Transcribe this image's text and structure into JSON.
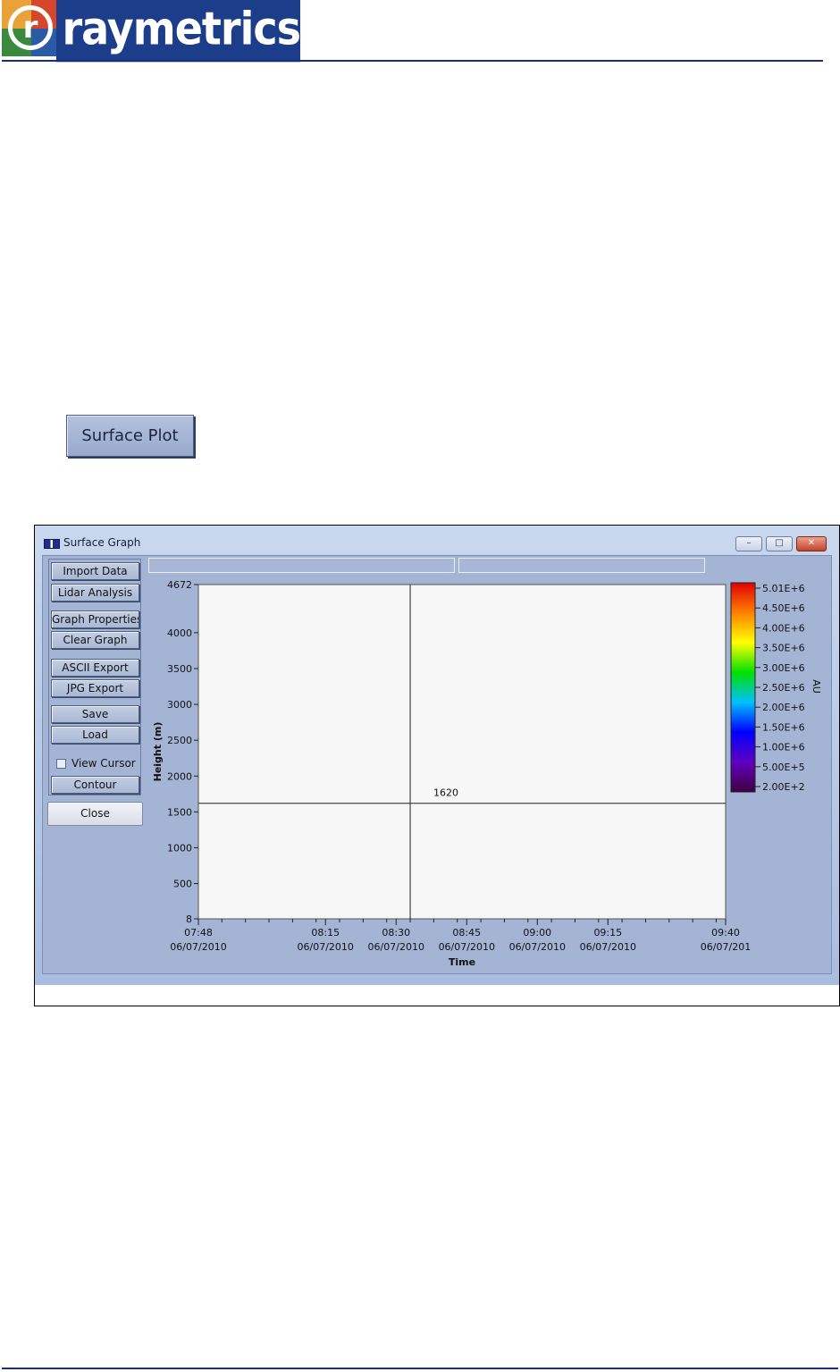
{
  "logo": {
    "wordmark": "raymetrics",
    "mark_letter": "r"
  },
  "button": {
    "surface_plot_label": "Surface Plot"
  },
  "window": {
    "title": "Surface Graph",
    "controls": {
      "minimize": "–",
      "maximize": "□",
      "close": "✕"
    }
  },
  "panel": {
    "buttons": [
      "Import Data",
      "Lidar Analysis",
      "Graph Properties",
      "Clear Graph",
      "ASCII Export",
      "JPG Export",
      "Save",
      "Load"
    ],
    "view_cursor_label": "View Cursor",
    "view_cursor_checked": false,
    "contour_label": "Contour",
    "close_label": "Close"
  },
  "chart_data": {
    "type": "heatmap",
    "xlabel": "Time",
    "ylabel": "Height (m)",
    "ylim": [
      8,
      4672
    ],
    "y_ticks": [
      "4672",
      "4000",
      "3500",
      "3000",
      "2500",
      "2000",
      "1500",
      "1000",
      "500",
      "8"
    ],
    "x_ticks": [
      {
        "time": "07:48",
        "date": "06/07/2010"
      },
      {
        "time": "08:15",
        "date": "06/07/2010"
      },
      {
        "time": "08:30",
        "date": "06/07/2010"
      },
      {
        "time": "08:45",
        "date": "06/07/2010"
      },
      {
        "time": "09:00",
        "date": "06/07/2010"
      },
      {
        "time": "09:15",
        "date": "06/07/2010"
      },
      {
        "time": "09:40",
        "date": "06/07/201"
      }
    ],
    "cursor": {
      "time": "08:33",
      "height": 1620,
      "label": "1620"
    },
    "colorbar": {
      "label": "AU",
      "ticks": [
        "5.01E+6",
        "4.50E+6",
        "4.00E+6",
        "3.50E+6",
        "3.00E+6",
        "2.50E+6",
        "2.00E+6",
        "1.50E+6",
        "1.00E+6",
        "5.00E+5",
        "2.00E+2"
      ],
      "colors": [
        "#e00000",
        "#ff8000",
        "#ffff00",
        "#00e000",
        "#00c0ff",
        "#0000ff",
        "#6000c0",
        "#400040"
      ]
    }
  }
}
